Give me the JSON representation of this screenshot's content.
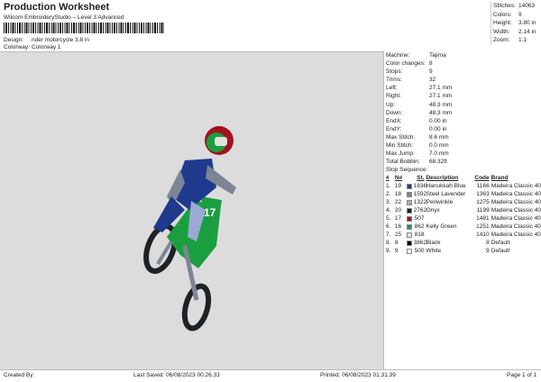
{
  "header": {
    "title": "Production Worksheet",
    "subtitle": "Wilcom EmbroideryStudio – Level 3 Advanced",
    "design_label": "Design:",
    "design": "rider motorcycle 3,8 in",
    "colorway_label": "Colorway:",
    "colorway": "Colorway 1"
  },
  "top_stats": [
    {
      "k": "Stitches:",
      "v": "14063"
    },
    {
      "k": "Colors:",
      "v": "9"
    },
    {
      "k": "Height:",
      "v": "3.80 in"
    },
    {
      "k": "Width:",
      "v": "2.14 in"
    },
    {
      "k": "Zoom:",
      "v": "1:1"
    }
  ],
  "info": [
    {
      "k": "Machine:",
      "v": "Tajima"
    },
    {
      "k": "Color changes:",
      "v": "8"
    },
    {
      "k": "Stops:",
      "v": "9"
    },
    {
      "k": "Trims:",
      "v": "32"
    },
    {
      "k": "Left:",
      "v": "27.1 mm"
    },
    {
      "k": "Right:",
      "v": "27.1 mm"
    },
    {
      "k": "Up:",
      "v": "48.3 mm"
    },
    {
      "k": "Down:",
      "v": "48.3 mm"
    },
    {
      "k": "EndX:",
      "v": "0.00 in"
    },
    {
      "k": "EndY:",
      "v": "0.00 in"
    },
    {
      "k": "Max Stitch:",
      "v": "8.6 mm"
    },
    {
      "k": "Min Stitch:",
      "v": "0.0 mm"
    },
    {
      "k": "Max Jump:",
      "v": "7.0 mm"
    },
    {
      "k": "Total Bobbin:",
      "v": "68.32ft"
    }
  ],
  "stop_sequence": {
    "label": "Stop Sequence:",
    "headers": [
      "#",
      "N#",
      "St.",
      "Description",
      "Code",
      "Brand"
    ],
    "rows": [
      {
        "n": "1.",
        "nn": "19",
        "color": "#1f3a8c",
        "st": "1836",
        "desc": "Hanukkah Blue",
        "code": "1166",
        "brand": "Madeira Classic 40"
      },
      {
        "n": "2.",
        "nn": "18",
        "color": "#7b8596",
        "st": "1592",
        "desc": "Steel Lavender",
        "code": "1363",
        "brand": "Madeira Classic 40"
      },
      {
        "n": "3.",
        "nn": "22",
        "color": "#9aaad4",
        "st": "1322",
        "desc": "Periwinkle",
        "code": "1275",
        "brand": "Madeira Classic 40"
      },
      {
        "n": "4.",
        "nn": "20",
        "color": "#1d2226",
        "st": "2762",
        "desc": "Onyx",
        "code": "1199",
        "brand": "Madeira Classic 40"
      },
      {
        "n": "5.",
        "nn": "17",
        "color": "#a3111f",
        "st": "507",
        "desc": "",
        "code": "1481",
        "brand": "Madeira Classic 40"
      },
      {
        "n": "6.",
        "nn": "16",
        "color": "#1b9e40",
        "st": "862",
        "desc": "Kelly Green",
        "code": "1251",
        "brand": "Madeira Classic 40"
      },
      {
        "n": "7.",
        "nn": "25",
        "color": "#e2e2dc",
        "st": "818",
        "desc": "",
        "code": "1410",
        "brand": "Madeira Classic 40"
      },
      {
        "n": "8.",
        "nn": "8",
        "color": "#000000",
        "st": "3862",
        "desc": "Black",
        "code": "8",
        "brand": "Default"
      },
      {
        "n": "9.",
        "nn": "9",
        "color": "#ffffff",
        "st": "500",
        "desc": "White",
        "code": "9",
        "brand": "Default"
      }
    ]
  },
  "footer": {
    "created": "Created By:",
    "saved": "Last Saved: 06/08/2023 00.26.33",
    "printed": "Printed: 06/08/2023 01.31.39",
    "page": "Page 1 of 1"
  }
}
